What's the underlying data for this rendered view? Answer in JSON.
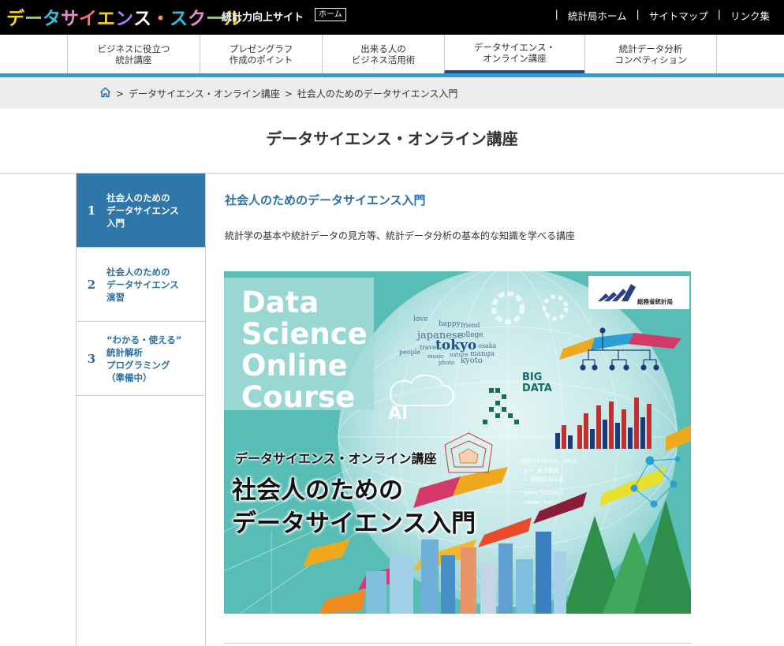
{
  "header": {
    "logo_text": "データサイエンス・スクール",
    "site_name": "統計力向上サイト",
    "home_badge": "ホーム",
    "links": [
      "統計局ホーム",
      "サイトマップ",
      "リンク集"
    ]
  },
  "nav": {
    "items": [
      {
        "label": "ビジネスに役立つ\n統計講座"
      },
      {
        "label": "プレゼングラフ\n作成のポイント"
      },
      {
        "label": "出来る人の\nビジネス活用術"
      },
      {
        "label": "データサイエンス・\nオンライン講座"
      },
      {
        "label": "統計データ分析\nコンペティション"
      }
    ]
  },
  "breadcrumb": {
    "items": [
      "データサイエンス・オンライン講座",
      "社会人のためのデータサイエンス入門"
    ]
  },
  "page_title": "データサイエンス・オンライン講座",
  "sidenav": {
    "items": [
      {
        "num": "1",
        "label": "社会人のための\nデータサイエンス\n入門"
      },
      {
        "num": "2",
        "label": "社会人のための\nデータサイエンス\n演習"
      },
      {
        "num": "3",
        "label": "“わかる・使える”\n統計解析\nプログラミング\n（準備中）"
      }
    ]
  },
  "content": {
    "title": "社会人のためのデータサイエンス入門",
    "description": "統計学の基本や統計データの見方等、統計データ分析の基本的な知識を学べる講座"
  },
  "hero": {
    "en_text": "Data\nScience\nOnline\nCourse",
    "subtitle": "データサイエンス・オンライン講座",
    "title_line1": "社会人のための",
    "title_line2": "データサイエンス入門",
    "ministry": "総務省統計局",
    "ai": "AI",
    "bigdata": "BIG\nDATA",
    "words": [
      "tokyo",
      "japanese",
      "love",
      "happy",
      "friend",
      "osaka",
      "kyoto",
      "manga",
      "people",
      "travel",
      "college",
      "music",
      "photo",
      "nature"
    ],
    "code_lines": [
      "ggplot(data, aes(",
      "y = 地方価格,",
      "= 経常収支比率",
      "geom_bin2d()",
      "theme_bw()"
    ]
  }
}
